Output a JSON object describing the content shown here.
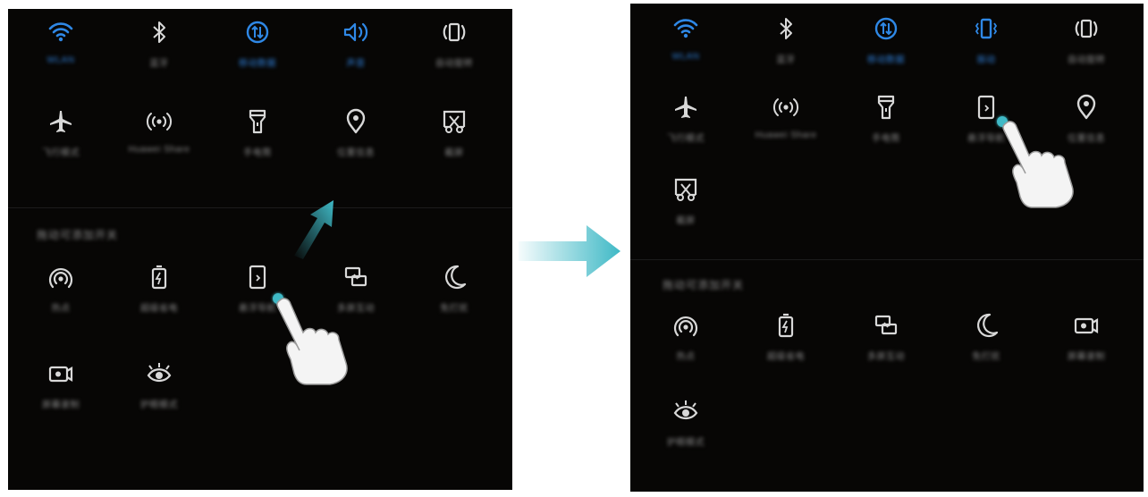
{
  "colors": {
    "active": "#2f88e6",
    "inactive": "#d8d8d8",
    "accent": "#3fb9c6",
    "panel_bg": "#070605"
  },
  "before": {
    "top_row": [
      {
        "icon": "wifi-icon",
        "label": "WLAN",
        "active": true
      },
      {
        "icon": "bluetooth-icon",
        "label": "蓝牙",
        "active": false
      },
      {
        "icon": "mobile-data-icon",
        "label": "移动数据",
        "active": true
      },
      {
        "icon": "sound-icon",
        "label": "声音",
        "active": true
      },
      {
        "icon": "auto-rotate-icon",
        "label": "自动旋转",
        "active": false
      }
    ],
    "second_row": [
      {
        "icon": "airplane-icon",
        "label": "飞行模式"
      },
      {
        "icon": "huawei-share-icon",
        "label": "Huawei Share"
      },
      {
        "icon": "flashlight-icon",
        "label": "手电筒"
      },
      {
        "icon": "location-icon",
        "label": "位置信息"
      },
      {
        "icon": "screenshot-icon",
        "label": "截屏"
      }
    ],
    "section_title": "拖动可添加开关",
    "extra_row1": [
      {
        "icon": "hotspot-icon",
        "label": "热点"
      },
      {
        "icon": "super-charge-icon",
        "label": "超级省电"
      },
      {
        "icon": "floating-dock-icon",
        "label": "悬浮导航"
      },
      {
        "icon": "multi-screen-icon",
        "label": "多屏互动"
      },
      {
        "icon": "moon-icon",
        "label": "免打扰"
      }
    ],
    "extra_row2": [
      {
        "icon": "screen-record-icon",
        "label": "屏幕录制"
      },
      {
        "icon": "eye-comfort-icon",
        "label": "护眼模式"
      }
    ]
  },
  "after": {
    "top_row": [
      {
        "icon": "wifi-icon",
        "label": "WLAN",
        "active": true
      },
      {
        "icon": "bluetooth-icon",
        "label": "蓝牙",
        "active": false
      },
      {
        "icon": "mobile-data-icon",
        "label": "移动数据",
        "active": true
      },
      {
        "icon": "vibrate-icon",
        "label": "振动",
        "active": true
      },
      {
        "icon": "auto-rotate-icon",
        "label": "自动旋转",
        "active": false
      }
    ],
    "second_row": [
      {
        "icon": "airplane-icon",
        "label": "飞行模式"
      },
      {
        "icon": "huawei-share-icon",
        "label": "Huawei Share"
      },
      {
        "icon": "flashlight-icon",
        "label": "手电筒"
      },
      {
        "icon": "floating-dock-icon",
        "label": "悬浮导航"
      },
      {
        "icon": "location-icon",
        "label": "位置信息"
      }
    ],
    "third_row": [
      {
        "icon": "screenshot-icon",
        "label": "截屏"
      }
    ],
    "section_title": "拖动可添加开关",
    "extra_row1": [
      {
        "icon": "hotspot-icon",
        "label": "热点"
      },
      {
        "icon": "super-charge-icon",
        "label": "超级省电"
      },
      {
        "icon": "multi-screen-icon",
        "label": "多屏互动"
      },
      {
        "icon": "moon-icon",
        "label": "免打扰"
      },
      {
        "icon": "screen-record-icon",
        "label": "屏幕录制"
      }
    ],
    "extra_row2": [
      {
        "icon": "eye-comfort-icon",
        "label": "护眼模式"
      }
    ]
  }
}
